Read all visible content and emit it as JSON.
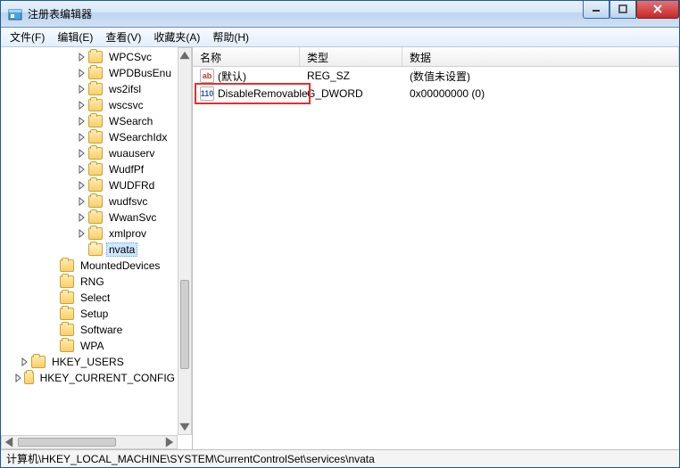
{
  "window": {
    "title": "注册表编辑器"
  },
  "menus": {
    "file": "文件(F)",
    "edit": "编辑(E)",
    "view": "查看(V)",
    "fav": "收藏夹(A)",
    "help": "帮助(H)"
  },
  "tree": {
    "services_children": [
      "WPCSvc",
      "WPDBusEnu",
      "ws2ifsl",
      "wscsvc",
      "WSearch",
      "WSearchIdx",
      "wuauserv",
      "WudfPf",
      "WUDFRd",
      "wudfsvc",
      "WwanSvc",
      "xmlprov",
      "nvata"
    ],
    "siblings_after_services": [
      "MountedDevices",
      "RNG",
      "Select",
      "Setup",
      "Software",
      "WPA"
    ],
    "roots_tail": [
      "HKEY_USERS",
      "HKEY_CURRENT_CONFIG"
    ],
    "selected": "nvata"
  },
  "list": {
    "headers": {
      "name": "名称",
      "type": "类型",
      "data": "数据"
    },
    "rows": [
      {
        "icon": "str",
        "name": "(默认)",
        "type": "REG_SZ",
        "data": "(数值未设置)"
      },
      {
        "icon": "dword",
        "name": "DisableRemovable",
        "type": "G_DWORD",
        "data": "0x00000000 (0)",
        "highlighted": true
      }
    ]
  },
  "statusbar": {
    "path": "计算机\\HKEY_LOCAL_MACHINE\\SYSTEM\\CurrentControlSet\\services\\nvata"
  }
}
